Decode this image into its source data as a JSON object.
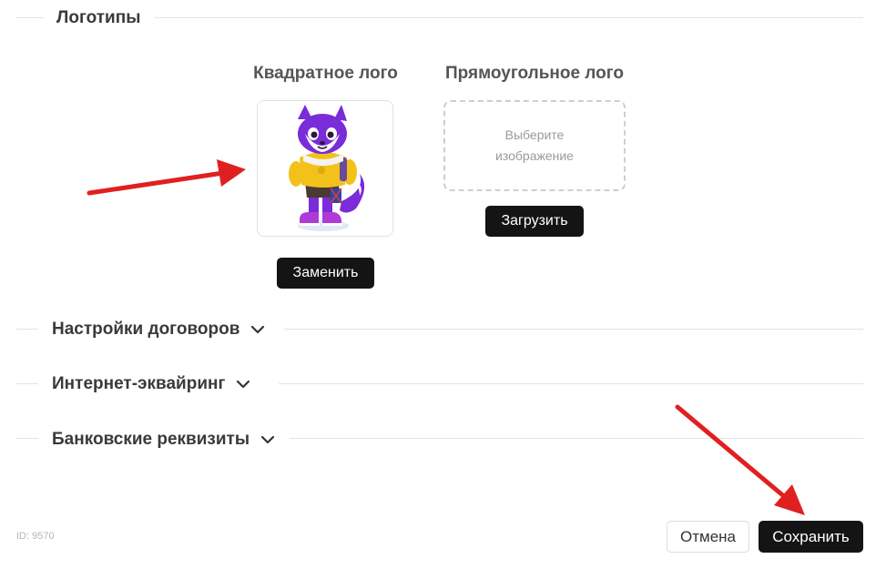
{
  "logos_section": {
    "title": "Логотипы",
    "square": {
      "label": "Квадратное лого",
      "replace_button": "Заменить"
    },
    "rect": {
      "label": "Прямоугольное лого",
      "placeholder_line1": "Выберите",
      "placeholder_line2": "изображение",
      "upload_button": "Загрузить"
    }
  },
  "collapsible_sections": [
    {
      "title": "Настройки договоров"
    },
    {
      "title": "Интернет-эквайринг"
    },
    {
      "title": "Банковские реквизиты"
    }
  ],
  "footer": {
    "id_label": "ID: 9570",
    "cancel_button": "Отмена",
    "save_button": "Сохранить"
  },
  "colors": {
    "primary_button": "#141414",
    "annotation_arrow": "#e02020",
    "mascot_purple": "#7a2cd8",
    "mascot_yellow": "#f2c21b"
  }
}
